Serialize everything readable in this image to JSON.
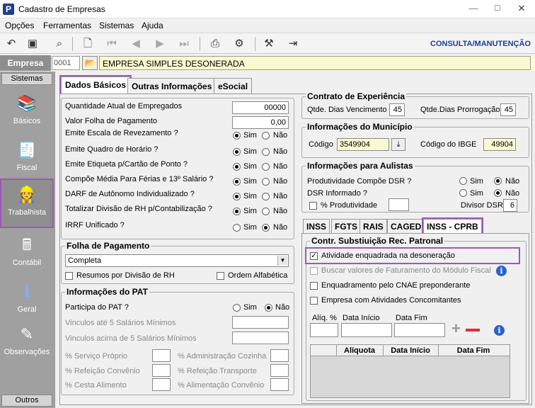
{
  "window": {
    "title": "Cadastro de Empresas",
    "minimize": "—",
    "maximize": "☐",
    "close": "✕"
  },
  "menu": [
    "Opções",
    "Ferramentas",
    "Sistemas",
    "Ajuda"
  ],
  "toolbar": {
    "mode": "CONSULTA/MANUTENÇÃO"
  },
  "empresa": {
    "label": "Empresa",
    "code": "0001",
    "name": "EMPRESA SIMPLES DESONERADA"
  },
  "sidebar": {
    "head": "Sistemas",
    "items": [
      {
        "label": "Básicos",
        "icon": "books-icon"
      },
      {
        "label": "Fiscal",
        "icon": "fiscal-icon"
      },
      {
        "label": "Trabalhista",
        "icon": "worker-icon"
      },
      {
        "label": "Contábil",
        "icon": "calculator-icon"
      },
      {
        "label": "Geral",
        "icon": "info-icon"
      },
      {
        "label": "Observações",
        "icon": "notes-icon"
      }
    ],
    "footer": "Outros"
  },
  "tabs": [
    "Dados Básicos",
    "Outras Informações",
    "eSocial"
  ],
  "left": {
    "fields": [
      {
        "label": "Quantidade Atual de Empregados",
        "value": "00000"
      },
      {
        "label": "Valor Folha de Pagamento",
        "value": "0,00"
      }
    ],
    "radios": [
      {
        "label": "Emite Escala de Revezamento ?",
        "value": "Sim"
      },
      {
        "label": "Emite Quadro de Horário ?",
        "value": "Sim"
      },
      {
        "label": "Emite Etiqueta p/Cartão de Ponto ?",
        "value": "Sim"
      },
      {
        "label": "Compõe Média Para Férias e 13º Salário ?",
        "value": "Sim"
      },
      {
        "label": "DARF de Autônomo Individualizado ?",
        "value": "Sim"
      },
      {
        "label": "Totalizar Divisão de RH p/Contabilização ?",
        "value": "Sim"
      },
      {
        "label": "IRRF Unificado ?",
        "value": "Não"
      }
    ],
    "sim": "Sim",
    "nao": "Não",
    "folha": {
      "title": "Folha de Pagamento",
      "selected": "Completa",
      "resumos": "Resumos por Divisão de RH",
      "ordem": "Ordem Alfabética"
    },
    "pat": {
      "title": "Informações do PAT",
      "participa": "Participa do PAT ?",
      "participa_value": "Não",
      "ate5": "Vinculos até 5 Salários Mínimos",
      "acima5": "Vinculos acima de 5 Salários Mínimos",
      "pct": [
        "% Serviço Próprio",
        "% Administração Cozinha",
        "% Refeição Convênio",
        "% Refeição Transporte",
        "% Cesta Alimento",
        "% Alimentação Convênio"
      ]
    }
  },
  "right": {
    "contrato": {
      "title": "Contrato de Experiência",
      "venc_label": "Qtde. Dias Vencimento",
      "venc": "45",
      "prorr_label": "Qtde.Dias Prorrogação",
      "prorr": "45"
    },
    "municipio": {
      "title": "Informações do Município",
      "codigo_label": "Código",
      "codigo": "3549904",
      "ibge_label": "Código do IBGE",
      "ibge": "49904"
    },
    "aulistas": {
      "title": "Informações para Aulistas",
      "prod_label": "Produtividade Compõe DSR ?",
      "prod": "Não",
      "dsr_label": "DSR Informado ?",
      "dsr": "Não",
      "pct_label": "% Produtividade",
      "divisor_label": "Divisor DSR",
      "divisor": "6"
    },
    "subtabs": [
      "INSS",
      "FGTS",
      "RAIS",
      "CAGED",
      "INSS - CPRB"
    ],
    "cprb": {
      "title": "Contr. Substiuição Rec. Patronal",
      "atividade": "Atividade enquadrada na desoneração",
      "buscar": "Buscar valores de Faturamento do Módulo Fiscal",
      "cnae": "Enquadramento pelo CNAE preponderante",
      "concomitantes": "Empresa com Atividades Concomitantes",
      "aliq": "Alíq. %",
      "inicio": "Data Início",
      "fim": "Data Fim",
      "columns": [
        "Alíquota",
        "Data Início",
        "Data Fim"
      ]
    }
  }
}
